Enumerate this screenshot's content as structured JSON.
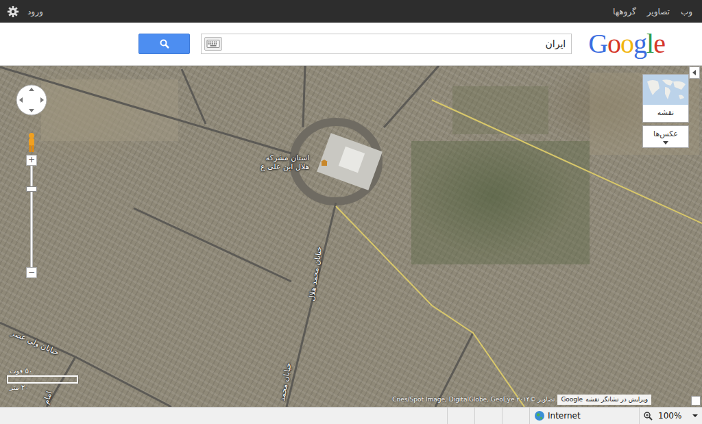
{
  "top_bar": {
    "links": [
      "وب",
      "تصاویر",
      "گروهها"
    ],
    "sign_in": "ورود"
  },
  "search": {
    "logo": "Google",
    "value": "ایران"
  },
  "map": {
    "place": {
      "lines": [
        "استان مشرکه",
        "هلال ابن علی ع"
      ]
    },
    "roads": [
      {
        "text": "خیابان محمد هلال"
      },
      {
        "text": "خیابان محمد"
      },
      {
        "text": "خیابان ولی عصر"
      },
      {
        "text": "امام"
      }
    ],
    "zoom": {
      "plus": "+",
      "minus": "−",
      "level": 0.77
    },
    "map_type": {
      "map_label": "نقشه",
      "photos_label": "عکس‌ها"
    },
    "scale": {
      "top": "۵۰ فوت",
      "bottom": "۲۰ متر"
    },
    "attribution": {
      "imagery": "تصاویر ©۲۰۱۴ Cnes/Spot Image, DigitalGlobe, GeoEye",
      "edit": "ویرایش در نشانگر نقشه",
      "brand": "Google"
    }
  },
  "status_bar": {
    "zone": "Internet",
    "zoom": "100%"
  }
}
